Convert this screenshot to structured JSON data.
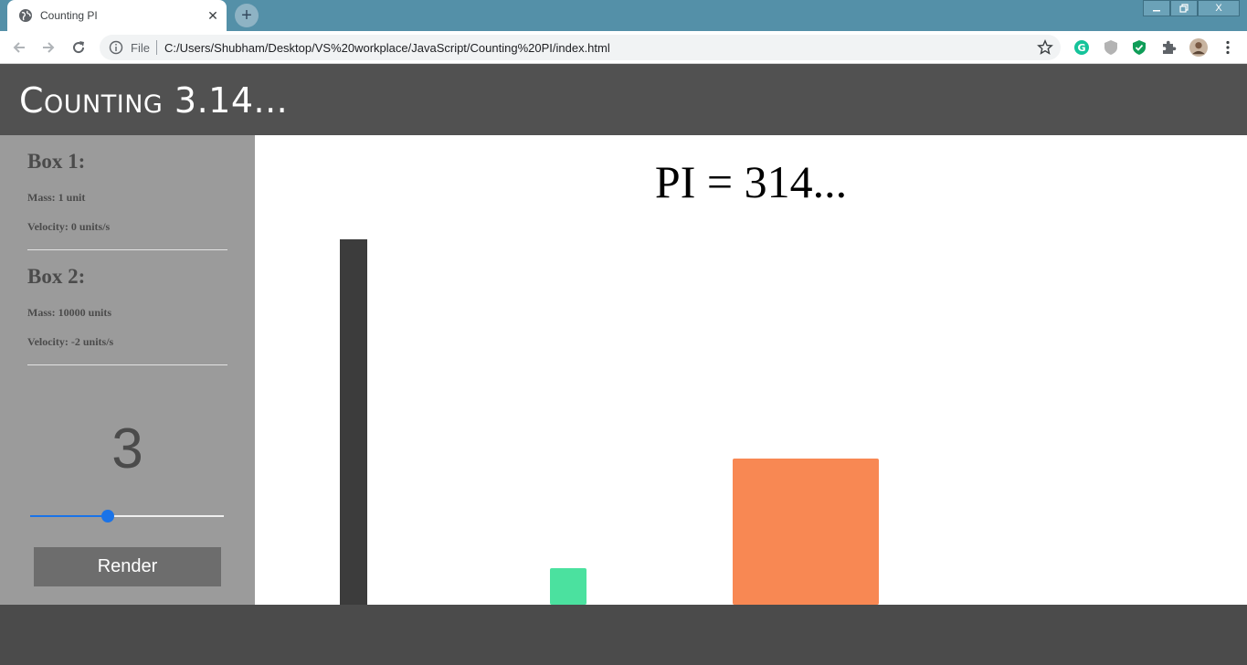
{
  "browser": {
    "tab_title": "Counting PI",
    "tab_close": "✕",
    "new_tab": "+",
    "file_label": "File",
    "url": "C:/Users/Shubham/Desktop/VS%20workplace/JavaScript/Counting%20PI/index.html",
    "window_controls": {
      "minimize": "—",
      "restore": "❐",
      "close": "X"
    }
  },
  "page": {
    "title": "Counting 3.14...",
    "box1": {
      "heading": "Box 1:",
      "mass": "Mass: 1 unit",
      "velocity": "Velocity: 0 units/s"
    },
    "box2": {
      "heading": "Box 2:",
      "mass": "Mass: 10000 units",
      "velocity": "Velocity: -2 units/s"
    },
    "digits": "3",
    "slider": {
      "value_fraction": 0.4
    },
    "render_label": "Render",
    "pi_display": "PI = 314..."
  },
  "colors": {
    "tabstrip": "#5490a8",
    "header": "#515151",
    "sidebar": "#9b9b9b",
    "wall": "#3c3c3c",
    "box1": "#4be19f",
    "box2": "#f88853",
    "accent": "#1a73e8"
  },
  "icons": {
    "back": "arrow-left-icon",
    "forward": "arrow-right-icon",
    "reload": "reload-icon",
    "info": "info-icon",
    "bookmark": "star-icon",
    "extensions": [
      "grammarly-icon",
      "shield-icon",
      "green-shield-icon",
      "puzzle-icon",
      "avatar",
      "menu-icon"
    ]
  }
}
